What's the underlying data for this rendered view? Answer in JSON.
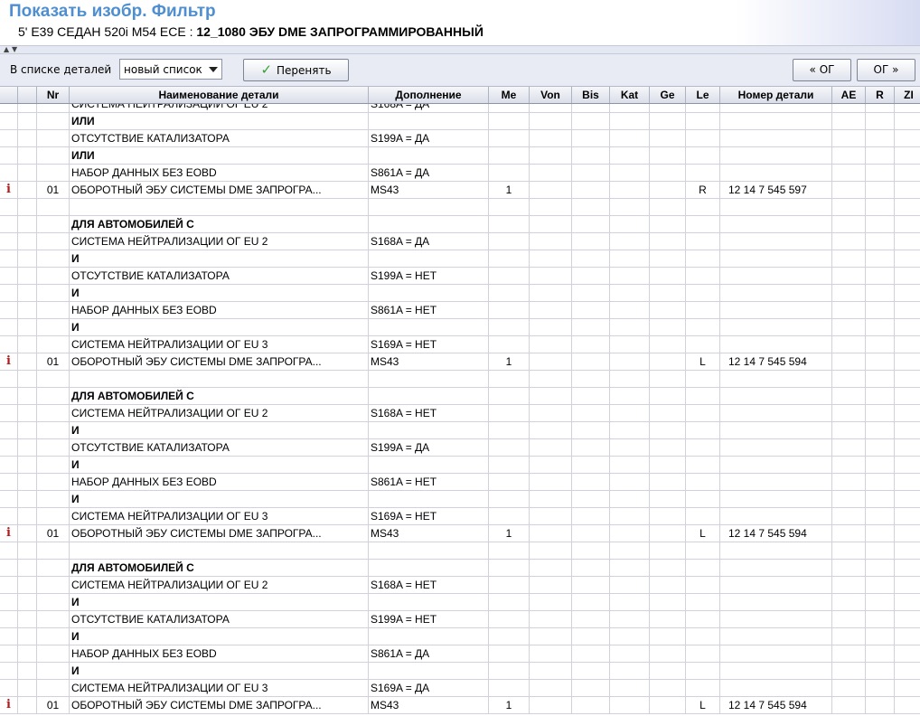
{
  "header": {
    "title": "Показать изобр. Фильтр",
    "vehicle": "5' E39 СЕДАН 520i M54 ECE : ",
    "group": "12_1080 ЭБУ DME ЗАПРОГРАММИРОВАННЫЙ"
  },
  "toolbar": {
    "list_label": "В списке деталей",
    "list_value": "новый список",
    "accept_label": "Перенять",
    "prev_label": "ОГ",
    "next_label": "ОГ"
  },
  "columns": [
    "",
    "",
    "Nr",
    "Наименование детали",
    "Дополнение",
    "Me",
    "Von",
    "Bis",
    "Kat",
    "Ge",
    "Le",
    "Номер детали",
    "AE",
    "R",
    "ZI"
  ],
  "rows": [
    {
      "info": false,
      "nr": "",
      "name": "СИСТЕМА НЕЙТРАЛИЗАЦИИ ОГ EU 2",
      "bold": false,
      "add": "S168A = ДА",
      "me": "",
      "le": "",
      "part": ""
    },
    {
      "info": false,
      "nr": "",
      "name": "ИЛИ",
      "bold": true,
      "add": "",
      "me": "",
      "le": "",
      "part": ""
    },
    {
      "info": false,
      "nr": "",
      "name": "ОТСУТСТВИЕ КАТАЛИЗАТОРА",
      "bold": false,
      "add": "S199A = ДА",
      "me": "",
      "le": "",
      "part": ""
    },
    {
      "info": false,
      "nr": "",
      "name": "ИЛИ",
      "bold": true,
      "add": "",
      "me": "",
      "le": "",
      "part": ""
    },
    {
      "info": false,
      "nr": "",
      "name": "НАБОР ДАННЫХ БЕЗ EOBD",
      "bold": false,
      "add": "S861A = ДА",
      "me": "",
      "le": "",
      "part": ""
    },
    {
      "info": true,
      "nr": "01",
      "name": "ОБОРОТНЫЙ ЭБУ СИСТЕМЫ DME ЗАПРОГРА...",
      "bold": false,
      "add": "MS43",
      "me": "1",
      "le": "R",
      "part": "12 14 7 545 597"
    },
    {
      "info": false,
      "nr": "",
      "name": "",
      "bold": false,
      "add": "",
      "me": "",
      "le": "",
      "part": ""
    },
    {
      "info": false,
      "nr": "",
      "name": "ДЛЯ АВТОМОБИЛЕЙ С",
      "bold": true,
      "add": "",
      "me": "",
      "le": "",
      "part": ""
    },
    {
      "info": false,
      "nr": "",
      "name": "СИСТЕМА НЕЙТРАЛИЗАЦИИ ОГ EU 2",
      "bold": false,
      "add": "S168A = ДА",
      "me": "",
      "le": "",
      "part": ""
    },
    {
      "info": false,
      "nr": "",
      "name": "И",
      "bold": true,
      "add": "",
      "me": "",
      "le": "",
      "part": ""
    },
    {
      "info": false,
      "nr": "",
      "name": "ОТСУТСТВИЕ КАТАЛИЗАТОРА",
      "bold": false,
      "add": "S199A = НЕТ",
      "me": "",
      "le": "",
      "part": ""
    },
    {
      "info": false,
      "nr": "",
      "name": "И",
      "bold": true,
      "add": "",
      "me": "",
      "le": "",
      "part": ""
    },
    {
      "info": false,
      "nr": "",
      "name": "НАБОР ДАННЫХ БЕЗ EOBD",
      "bold": false,
      "add": "S861A = НЕТ",
      "me": "",
      "le": "",
      "part": ""
    },
    {
      "info": false,
      "nr": "",
      "name": "И",
      "bold": true,
      "add": "",
      "me": "",
      "le": "",
      "part": ""
    },
    {
      "info": false,
      "nr": "",
      "name": "СИСТЕМА НЕЙТРАЛИЗАЦИИ ОГ EU 3",
      "bold": false,
      "add": "S169A = НЕТ",
      "me": "",
      "le": "",
      "part": ""
    },
    {
      "info": true,
      "nr": "01",
      "name": "ОБОРОТНЫЙ ЭБУ СИСТЕМЫ DME ЗАПРОГРА...",
      "bold": false,
      "add": "MS43",
      "me": "1",
      "le": "L",
      "part": "12 14 7 545 594"
    },
    {
      "info": false,
      "nr": "",
      "name": "",
      "bold": false,
      "add": "",
      "me": "",
      "le": "",
      "part": ""
    },
    {
      "info": false,
      "nr": "",
      "name": "ДЛЯ АВТОМОБИЛЕЙ С",
      "bold": true,
      "add": "",
      "me": "",
      "le": "",
      "part": ""
    },
    {
      "info": false,
      "nr": "",
      "name": "СИСТЕМА НЕЙТРАЛИЗАЦИИ ОГ EU 2",
      "bold": false,
      "add": "S168A = НЕТ",
      "me": "",
      "le": "",
      "part": ""
    },
    {
      "info": false,
      "nr": "",
      "name": "И",
      "bold": true,
      "add": "",
      "me": "",
      "le": "",
      "part": ""
    },
    {
      "info": false,
      "nr": "",
      "name": "ОТСУТСТВИЕ КАТАЛИЗАТОРА",
      "bold": false,
      "add": "S199A = ДА",
      "me": "",
      "le": "",
      "part": ""
    },
    {
      "info": false,
      "nr": "",
      "name": "И",
      "bold": true,
      "add": "",
      "me": "",
      "le": "",
      "part": ""
    },
    {
      "info": false,
      "nr": "",
      "name": "НАБОР ДАННЫХ БЕЗ EOBD",
      "bold": false,
      "add": "S861A = НЕТ",
      "me": "",
      "le": "",
      "part": ""
    },
    {
      "info": false,
      "nr": "",
      "name": "И",
      "bold": true,
      "add": "",
      "me": "",
      "le": "",
      "part": ""
    },
    {
      "info": false,
      "nr": "",
      "name": "СИСТЕМА НЕЙТРАЛИЗАЦИИ ОГ EU 3",
      "bold": false,
      "add": "S169A = НЕТ",
      "me": "",
      "le": "",
      "part": ""
    },
    {
      "info": true,
      "nr": "01",
      "name": "ОБОРОТНЫЙ ЭБУ СИСТЕМЫ DME ЗАПРОГРА...",
      "bold": false,
      "add": "MS43",
      "me": "1",
      "le": "L",
      "part": "12 14 7 545 594"
    },
    {
      "info": false,
      "nr": "",
      "name": "",
      "bold": false,
      "add": "",
      "me": "",
      "le": "",
      "part": ""
    },
    {
      "info": false,
      "nr": "",
      "name": "ДЛЯ АВТОМОБИЛЕЙ С",
      "bold": true,
      "add": "",
      "me": "",
      "le": "",
      "part": ""
    },
    {
      "info": false,
      "nr": "",
      "name": "СИСТЕМА НЕЙТРАЛИЗАЦИИ ОГ EU 2",
      "bold": false,
      "add": "S168A = НЕТ",
      "me": "",
      "le": "",
      "part": ""
    },
    {
      "info": false,
      "nr": "",
      "name": "И",
      "bold": true,
      "add": "",
      "me": "",
      "le": "",
      "part": ""
    },
    {
      "info": false,
      "nr": "",
      "name": "ОТСУТСТВИЕ КАТАЛИЗАТОРА",
      "bold": false,
      "add": "S199A = НЕТ",
      "me": "",
      "le": "",
      "part": ""
    },
    {
      "info": false,
      "nr": "",
      "name": "И",
      "bold": true,
      "add": "",
      "me": "",
      "le": "",
      "part": ""
    },
    {
      "info": false,
      "nr": "",
      "name": "НАБОР ДАННЫХ БЕЗ EOBD",
      "bold": false,
      "add": "S861A = ДА",
      "me": "",
      "le": "",
      "part": ""
    },
    {
      "info": false,
      "nr": "",
      "name": "И",
      "bold": true,
      "add": "",
      "me": "",
      "le": "",
      "part": ""
    },
    {
      "info": false,
      "nr": "",
      "name": "СИСТЕМА НЕЙТРАЛИЗАЦИИ ОГ EU 3",
      "bold": false,
      "add": "S169A = ДА",
      "me": "",
      "le": "",
      "part": ""
    },
    {
      "info": true,
      "nr": "01",
      "name": "ОБОРОТНЫЙ ЭБУ СИСТЕМЫ DME ЗАПРОГРА...",
      "bold": false,
      "add": "MS43",
      "me": "1",
      "le": "L",
      "part": "12 14 7 545 594"
    }
  ],
  "icons": {
    "info": "info-icon",
    "accept": "checkmark-icon",
    "prev": "double-chevron-left-icon",
    "next": "double-chevron-right-icon",
    "dropdown": "chevron-down-icon"
  },
  "colors": {
    "title": "#4f8fd0",
    "info_icon": "#b01c1c",
    "check": "#33a233"
  }
}
